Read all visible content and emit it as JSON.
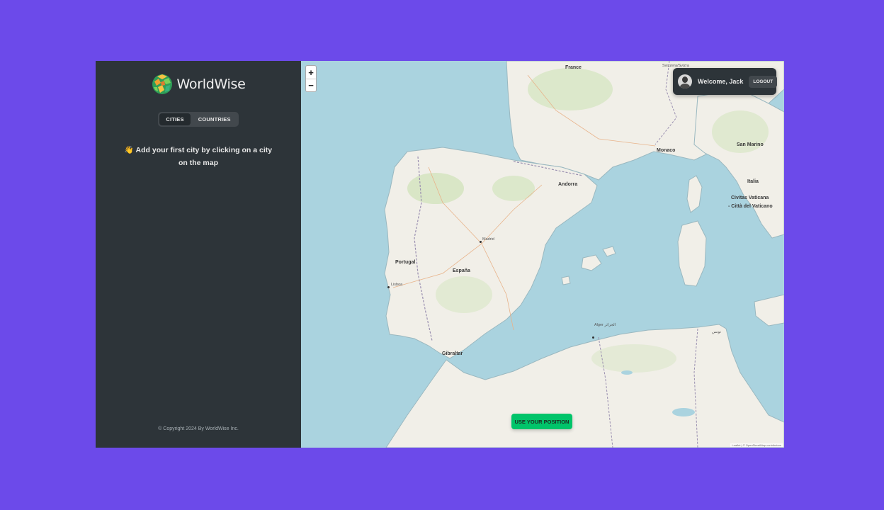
{
  "brand": {
    "name": "WorldWise"
  },
  "nav": {
    "tabs": [
      {
        "label": "Cities"
      },
      {
        "label": "Countries"
      }
    ]
  },
  "sidebar": {
    "message": "👋 Add your first city by clicking on a city on the map",
    "copyright": "© Copyright 2024 By WorldWise Inc."
  },
  "user": {
    "welcome": "Welcome, Jack",
    "logout_label": "Logout"
  },
  "map": {
    "zoom_in": "+",
    "zoom_out": "−",
    "position_button": "Use your position",
    "attribution": "Leaflet | © OpenStreetMap contributors",
    "labels": {
      "france": "France",
      "andorra": "Andorra",
      "monaco": "Monaco",
      "san_marino": "San Marino",
      "italia": "Italia",
      "vaticano_1": "Civitas Vaticana",
      "vaticano_2": "- Città del Vaticano",
      "portugal": "Portugal",
      "lisboa": "Lisboa",
      "madrid": "Madrid",
      "espana": "España",
      "gibraltar": "Gibraltar",
      "alger": "Alger الجزائر",
      "tunis": "تونس",
      "svizzera": "Svizzera/Svizra"
    }
  },
  "colors": {
    "page_bg": "#6c4aea",
    "sidebar_bg": "#2d3439",
    "accent_green": "#00c46a",
    "sea": "#aad3df",
    "land": "#f2efe9"
  }
}
